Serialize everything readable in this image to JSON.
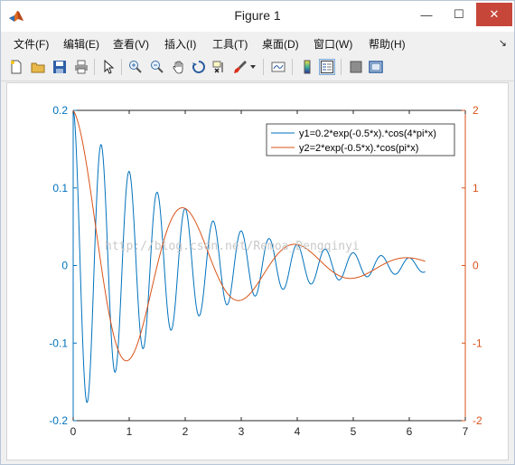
{
  "window": {
    "title": "Figure 1",
    "minimize_glyph": "—",
    "maximize_glyph": "☐",
    "close_glyph": "✕"
  },
  "menu": {
    "items": [
      "文件(F)",
      "编辑(E)",
      "查看(V)",
      "插入(I)",
      "工具(T)",
      "桌面(D)",
      "窗口(W)",
      "帮助(H)"
    ],
    "overflow_glyph": "↘"
  },
  "toolbar": {
    "icons": [
      "new-figure-icon",
      "open-file-icon",
      "save-icon",
      "print-icon",
      "edit-plot-arrow-icon",
      "zoom-in-icon",
      "zoom-out-icon",
      "pan-hand-icon",
      "rotate-3d-icon",
      "data-cursor-icon",
      "brush-icon",
      "brush-dropdown-icon",
      "link-plot-icon",
      "colorbar-icon",
      "legend-icon",
      "hide-plot-tools-icon",
      "show-plot-tools-icon"
    ]
  },
  "watermark": "http://blog.csdn.net/Remoa_Dengqinyi",
  "chart_data": {
    "type": "line",
    "xlim": [
      0,
      7
    ],
    "ylim_left": [
      -0.2,
      0.2
    ],
    "ylim_right": [
      -2,
      2
    ],
    "x_ticks": [
      "0",
      "1",
      "2",
      "3",
      "4",
      "5",
      "6",
      "7"
    ],
    "y_left_ticks": [
      "0.2",
      "0.1",
      "0",
      "-0.1",
      "-0.2"
    ],
    "y_right_ticks": [
      "2",
      "1",
      "0",
      "-1",
      "-2"
    ],
    "grid": false,
    "legend_position": "top-right",
    "colors": {
      "left": "#0072bd",
      "right": "#d95319"
    },
    "x_range": [
      0,
      6.2832
    ],
    "series": [
      {
        "name": "y1=0.2*exp(-0.5*x).*cos(4*pi*x)",
        "axis": "left",
        "color": "#0072bd",
        "amplitude": 0.2,
        "decay": 0.5,
        "frequency": 4
      },
      {
        "name": "y2=2*exp(-0.5*x).*cos(pi*x)",
        "axis": "right",
        "color": "#d95319",
        "amplitude": 2,
        "decay": 0.5,
        "frequency": 1
      }
    ]
  }
}
